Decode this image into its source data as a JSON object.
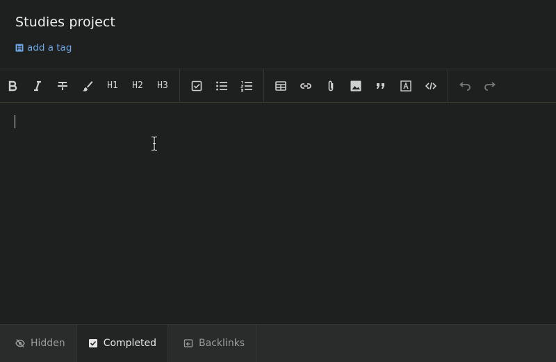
{
  "note": {
    "title": "Studies project",
    "add_tag_label": "add a tag"
  },
  "toolbar": {
    "h1": "H1",
    "h2": "H2",
    "h3": "H3"
  },
  "footer": {
    "tabs": [
      {
        "label": "Hidden",
        "icon": "eye-off-icon",
        "active": false
      },
      {
        "label": "Completed",
        "icon": "checkbox-checked-icon",
        "active": true
      },
      {
        "label": "Backlinks",
        "icon": "backlinks-icon",
        "active": false
      }
    ]
  },
  "colors": {
    "background": "#1e1f1f",
    "link": "#6fa7e6",
    "footer": "#2a2b2b"
  }
}
